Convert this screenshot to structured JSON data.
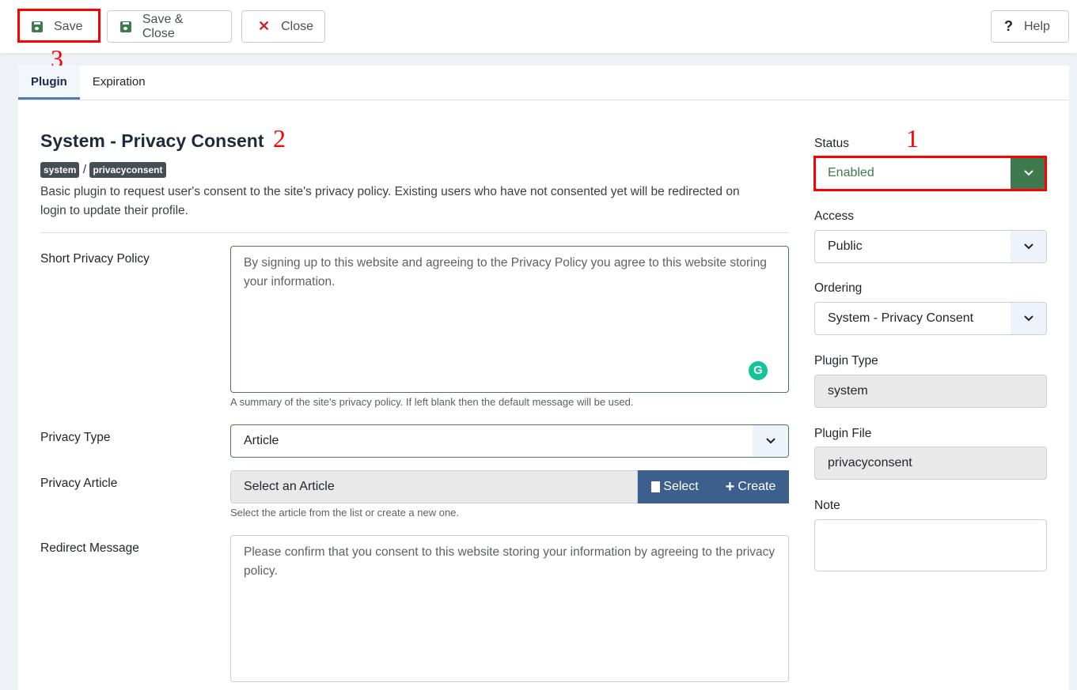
{
  "toolbar": {
    "save": "Save",
    "save_close": "Save & Close",
    "close": "Close",
    "help": "Help"
  },
  "tabs": [
    {
      "label": "Plugin",
      "active": true
    },
    {
      "label": "Expiration",
      "active": false
    }
  ],
  "plugin": {
    "title": "System - Privacy Consent",
    "badges": [
      "system",
      "privacyconsent"
    ],
    "separator": "/",
    "description": "Basic plugin to request user's consent to the site's privacy policy. Existing users who have not consented yet will be redirected on login to update their profile."
  },
  "form": {
    "short_policy": {
      "label": "Short Privacy Policy",
      "placeholder": "By signing up to this website and agreeing to the Privacy Policy you agree to this website storing your information.",
      "help": "A summary of the site's privacy policy. If left blank then the default message will be used."
    },
    "privacy_type": {
      "label": "Privacy Type",
      "value": "Article"
    },
    "privacy_article": {
      "label": "Privacy Article",
      "value": "Select an Article",
      "select": "Select",
      "create": "Create",
      "help": "Select the article from the list or create a new one."
    },
    "redirect": {
      "label": "Redirect Message",
      "placeholder": "Please confirm that you consent to this website storing your information by agreeing to the privacy policy."
    }
  },
  "sidebar": {
    "status": {
      "label": "Status",
      "value": "Enabled"
    },
    "access": {
      "label": "Access",
      "value": "Public"
    },
    "ordering": {
      "label": "Ordering",
      "value": "System - Privacy Consent"
    },
    "plugin_type": {
      "label": "Plugin Type",
      "value": "system"
    },
    "plugin_file": {
      "label": "Plugin File",
      "value": "privacyconsent"
    },
    "note": {
      "label": "Note",
      "value": ""
    }
  },
  "annotations": [
    "1",
    "2",
    "3"
  ],
  "colors": {
    "accent_green": "#3e7a4d",
    "button_blue": "#3d5f8c",
    "annotation": "#ff0000"
  }
}
